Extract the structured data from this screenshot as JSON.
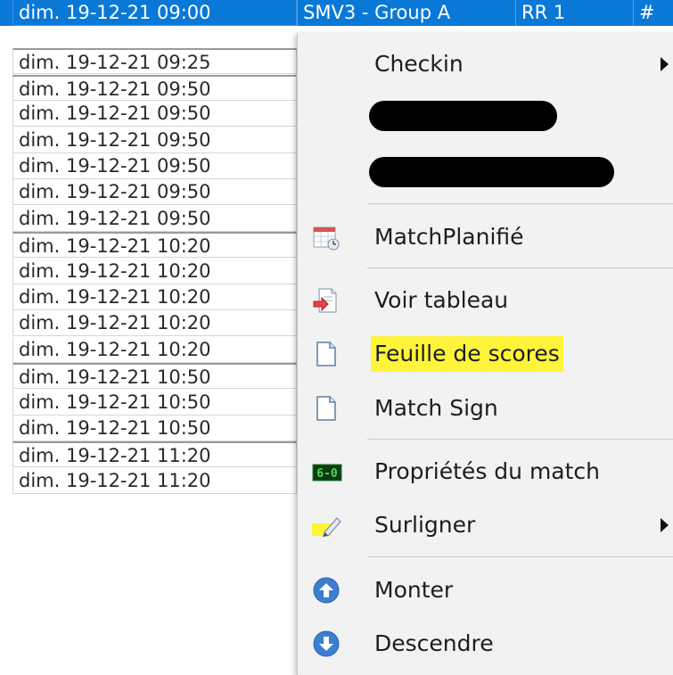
{
  "grid": {
    "selected_row": {
      "date": "dim. 19-12-21 09:00",
      "event": "SMV3 - Group A",
      "round": "RR 1",
      "extra": "#"
    },
    "rows": [
      {
        "date": "dim. 19-12-21 09:25",
        "group_start": true
      },
      {
        "date": "dim. 19-12-21 09:50",
        "group_start": true
      },
      {
        "date": "dim. 19-12-21 09:50",
        "group_start": false
      },
      {
        "date": "dim. 19-12-21 09:50",
        "group_start": false
      },
      {
        "date": "dim. 19-12-21 09:50",
        "group_start": false
      },
      {
        "date": "dim. 19-12-21 09:50",
        "group_start": false
      },
      {
        "date": "dim. 19-12-21 09:50",
        "group_start": false
      },
      {
        "date": "dim. 19-12-21 10:20",
        "group_start": true
      },
      {
        "date": "dim. 19-12-21 10:20",
        "group_start": false
      },
      {
        "date": "dim. 19-12-21 10:20",
        "group_start": false
      },
      {
        "date": "dim. 19-12-21 10:20",
        "group_start": false
      },
      {
        "date": "dim. 19-12-21 10:20",
        "group_start": false
      },
      {
        "date": "dim. 19-12-21 10:50",
        "group_start": true
      },
      {
        "date": "dim. 19-12-21 10:50",
        "group_start": false
      },
      {
        "date": "dim. 19-12-21 10:50",
        "group_start": false
      },
      {
        "date": "dim. 19-12-21 11:20",
        "group_start": true
      },
      {
        "date": "dim. 19-12-21 11:20",
        "group_start": false
      }
    ]
  },
  "context_menu": {
    "items": [
      {
        "id": "checkin",
        "label": "Checkin",
        "icon": "none",
        "submenu": true
      },
      {
        "id": "redacted-1",
        "label": "",
        "icon": "none",
        "redacted": true
      },
      {
        "id": "redacted-2",
        "label": "",
        "icon": "none",
        "redacted": true
      },
      {
        "id": "match-planifie",
        "label": "MatchPlanifié",
        "icon": "calendar-icon"
      },
      {
        "id": "voir-tableau",
        "label": "Voir tableau",
        "icon": "open-draw-icon"
      },
      {
        "id": "feuille-de-scores",
        "label": "Feuille de scores",
        "icon": "document-icon",
        "highlighted": true
      },
      {
        "id": "match-sign",
        "label": "Match Sign",
        "icon": "document-icon"
      },
      {
        "id": "proprietes-du-match",
        "label": "Propriétés du match",
        "icon": "scoreboard-icon",
        "icon_text": "6-0"
      },
      {
        "id": "surligner",
        "label": "Surligner",
        "icon": "highlighter-icon",
        "submenu": true
      },
      {
        "id": "monter",
        "label": "Monter",
        "icon": "arrow-up-circle-icon"
      },
      {
        "id": "descendre",
        "label": "Descendre",
        "icon": "arrow-down-circle-icon"
      }
    ]
  },
  "colors": {
    "selection": "#0a78d7",
    "highlight": "#fff43a",
    "menu_bg": "#f2f2f2",
    "icon_blue": "#3c7fd1",
    "scoreboard_green": "#1c7a28"
  }
}
